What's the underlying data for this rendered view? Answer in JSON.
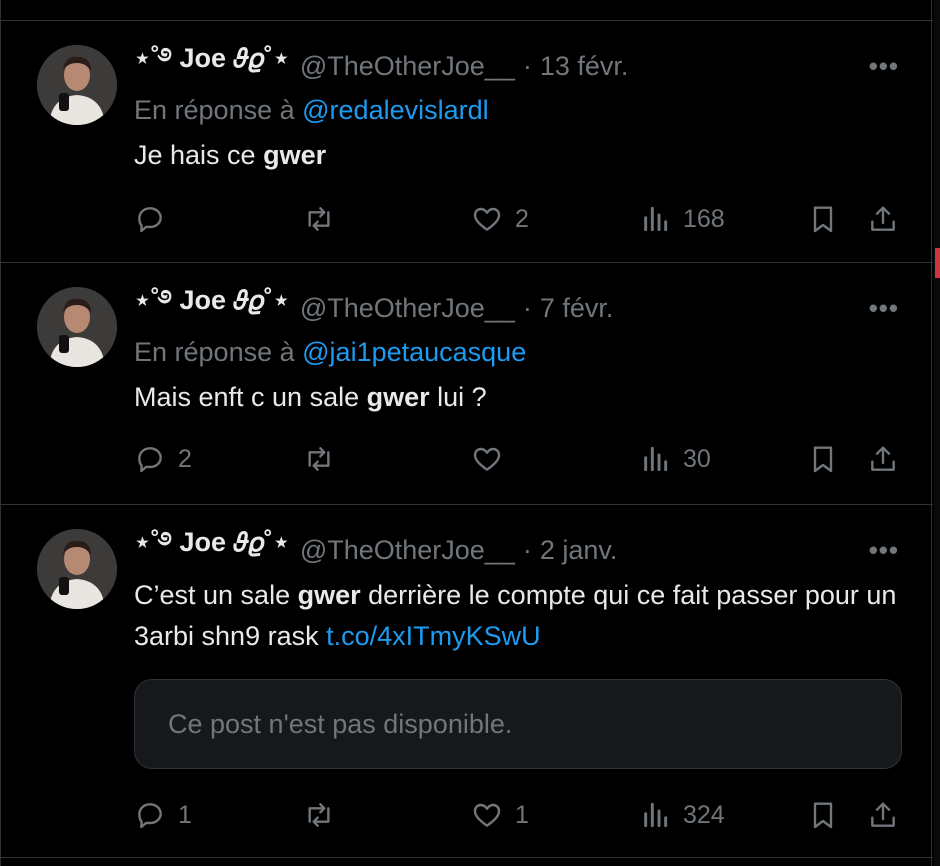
{
  "tweets": [
    {
      "name": "⋆˚࿔ Joe 𝜗𝜚˚⋆",
      "handle": "@TheOtherJoe__",
      "separator": "·",
      "date": "13 févr.",
      "reply_prefix": "En réponse à",
      "reply_to": "@redalevislardl",
      "text_before": "Je hais ce ",
      "text_bold": "gwer",
      "text_after": "",
      "replies": "",
      "likes": "2",
      "views": "168"
    },
    {
      "name": "⋆˚࿔ Joe 𝜗𝜚˚⋆",
      "handle": "@TheOtherJoe__",
      "separator": "·",
      "date": "7 févr.",
      "reply_prefix": "En réponse à",
      "reply_to": "@jai1petaucasque",
      "text_before": "Mais enft c un sale ",
      "text_bold": "gwer",
      "text_after": " lui ?",
      "replies": "2",
      "likes": "",
      "views": "30"
    },
    {
      "name": "⋆˚࿔ Joe 𝜗𝜚˚⋆",
      "handle": "@TheOtherJoe__",
      "separator": "·",
      "date": "2 janv.",
      "text_before": "C’est un sale ",
      "text_bold": "gwer",
      "text_after": " derrière le compte qui ce fait passer pour un 3arbi shn9 rask ",
      "text_link": "t.co/4xITmyKSwU",
      "quote_unavailable": "Ce post n'est pas disponible.",
      "replies": "1",
      "likes": "1",
      "views": "324"
    }
  ],
  "icons": {
    "more": "more-icon",
    "reply": "reply-icon",
    "retweet": "retweet-icon",
    "like": "heart-icon",
    "views": "views-icon",
    "bookmark": "bookmark-icon",
    "share": "share-icon"
  },
  "colors": {
    "background": "#000000",
    "text": "#e7e9ea",
    "muted": "#71767b",
    "link": "#1d9bf0",
    "border": "#2f3336"
  }
}
